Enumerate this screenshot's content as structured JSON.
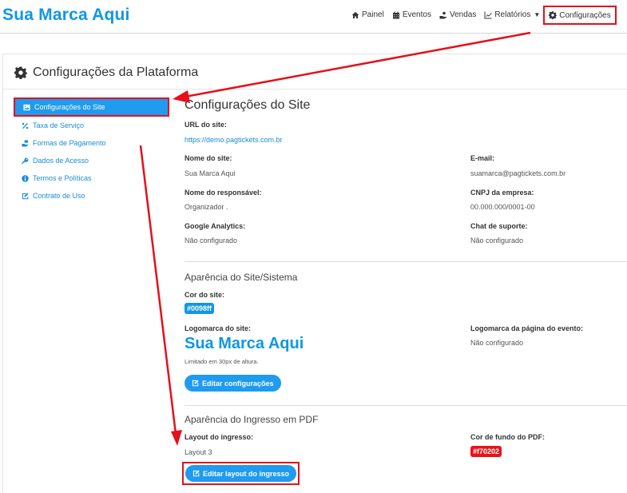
{
  "brand": {
    "name": "Sua Marca Aqui",
    "color": "#0f97e3"
  },
  "nav": {
    "items": [
      {
        "label": "Painel",
        "icon": "home-icon"
      },
      {
        "label": "Eventos",
        "icon": "calendar-icon"
      },
      {
        "label": "Vendas",
        "icon": "hand-coins-icon"
      },
      {
        "label": "Relatórios",
        "icon": "chart-line-icon"
      }
    ],
    "settings": {
      "label": "Configurações",
      "icon": "gear-icon"
    }
  },
  "panel": {
    "title": "Configurações da Plataforma",
    "icon": "gear-icon"
  },
  "sidebar": {
    "items": [
      {
        "label": "Configurações do Site",
        "icon": "image-icon",
        "active": true
      },
      {
        "label": "Taxa de Serviço",
        "icon": "percent-icon"
      },
      {
        "label": "Formas de Pagamento",
        "icon": "hand-money-icon"
      },
      {
        "label": "Dados de Acesso",
        "icon": "key-icon"
      },
      {
        "label": "Termos e Políticas",
        "icon": "info-icon"
      },
      {
        "label": "Contrato de Uso",
        "icon": "signature-icon"
      }
    ]
  },
  "site": {
    "title": "Configurações do Site",
    "url_label": "URL do site:",
    "url_value": "https://demo.pagtickets.com.br",
    "name_label": "Nome do site:",
    "name_value": "Sua Marca Aqui",
    "email_label": "E-mail:",
    "email_value": "suamarca@pagtickets.com.br",
    "owner_label": "Nome do responsável:",
    "owner_value": "Organizador .",
    "cnpj_label": "CNPJ da empresa:",
    "cnpj_value": "00.000.000/0001-00",
    "ga_label": "Google Analytics:",
    "ga_value": "Não configurado",
    "chat_label": "Chat de suporte:",
    "chat_value": "Não configurado"
  },
  "appearance": {
    "title": "Aparência do Site/Sistema",
    "color_label": "Cor do site:",
    "color_value": "#0098ff",
    "logo_label": "Logomarca do site:",
    "logo_text": "Sua Marca Aqui",
    "logo_note": "Limitado em 30px de altura.",
    "event_logo_label": "Logomarca da página do evento:",
    "event_logo_value": "Não configurado",
    "edit_button": "Editar configurações"
  },
  "ticket": {
    "title": "Aparência do Ingresso em PDF",
    "layout_label": "Layout do ingresso:",
    "layout_value": "Layout 3",
    "bg_label": "Cor de fundo do PDF:",
    "bg_value": "#f70202",
    "edit_button": "Editar layout do ingresso"
  },
  "colors": {
    "accent": "#1f9bf0",
    "highlight": "#e4101a",
    "link": "#1b8bd8"
  }
}
